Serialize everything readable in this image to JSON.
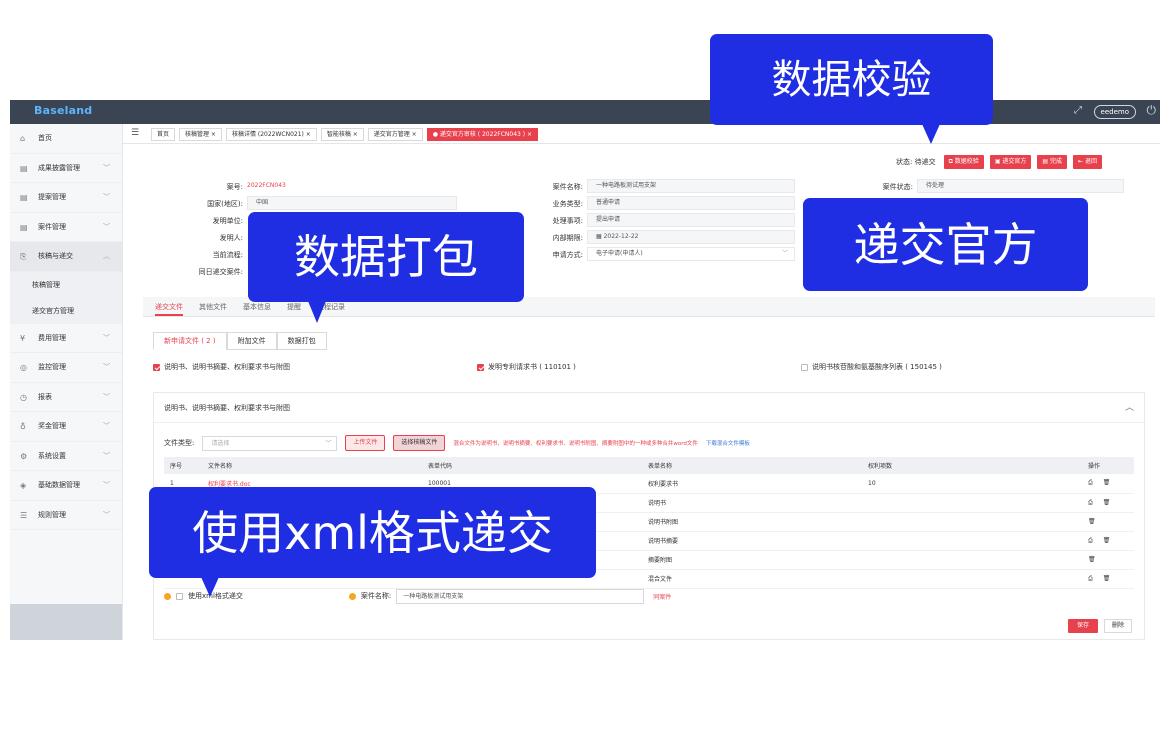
{
  "topbar": {
    "logo": "Baseland",
    "user": "eedemo",
    "expand_icon": "expand-icon",
    "power_icon": "power-icon"
  },
  "sidebar": {
    "items": [
      {
        "label": "首页",
        "icon": "home-icon"
      },
      {
        "label": "成果披露管理",
        "icon": "list-icon"
      },
      {
        "label": "提案管理",
        "icon": "list-icon"
      },
      {
        "label": "案件管理",
        "icon": "list-icon"
      },
      {
        "label": "核稿与递交",
        "icon": "file-icon"
      },
      {
        "label": "核稿管理",
        "icon": ""
      },
      {
        "label": "递交官方管理",
        "icon": ""
      },
      {
        "label": "费用管理",
        "icon": "money-icon"
      },
      {
        "label": "监控管理",
        "icon": "monitor-icon"
      },
      {
        "label": "报表",
        "icon": "clock-icon"
      },
      {
        "label": "奖金管理",
        "icon": "award-icon"
      },
      {
        "label": "系统设置",
        "icon": "gear-icon"
      },
      {
        "label": "基础数据管理",
        "icon": "layers-icon"
      },
      {
        "label": "规则管理",
        "icon": "sliders-icon"
      }
    ]
  },
  "breadcrumbs": [
    "首页",
    "核稿管理 ×",
    "核稿详情 (2022WCN021) ×",
    "智能核稿 ×",
    "递交官方管理 ×",
    "● 递交官方审核 ( 2022FCN043 ) ×"
  ],
  "actions": {
    "status": "状态: 待递交",
    "buttons": [
      "数据校验",
      "递交官方",
      "完成",
      "退回"
    ]
  },
  "form": {
    "case_no_label": "案号:",
    "case_no": "2022FCN043",
    "country_label": "国家(地区):",
    "country": "中国",
    "applicant_unit_label": "发明单位:",
    "inventor_label": "发明人:",
    "current_flow_label": "当前流程:",
    "same_submit_label": "同日递交案件:",
    "case_name_label": "案件名称:",
    "case_name": "一种电路板测试用支架",
    "business_type_label": "业务类型:",
    "business_type": "普通申请",
    "process_label": "处理事项:",
    "process": "提出申请",
    "deadline_label": "内部期限:",
    "deadline": "2022-12-22",
    "apply_method_label": "申请方式:",
    "apply_method": "电子申请(申请人)",
    "case_status_label": "案件状态:",
    "case_status": "待处理"
  },
  "tabs_main": [
    "递交文件",
    "其他文件",
    "基本信息",
    "提醒",
    "流程记录"
  ],
  "tabs_sub": [
    "新申请文件 ( 2 )",
    "附加文件",
    "数据打包"
  ],
  "checkboxes": [
    {
      "label": "说明书、说明书摘要、权利要求书与附图",
      "checked": true
    },
    {
      "label": "发明专利请求书 ( 110101 )",
      "checked": true
    },
    {
      "label": "说明书核苷酸和氨基酸序列表 ( 150145 )",
      "checked": false
    }
  ],
  "section": {
    "title": "说明书、说明书摘要、权利要求书与附图",
    "file_type_label": "文件类型:",
    "file_type_placeholder": "请选择",
    "upload_btn": "上传文件",
    "select_btn": "选择核稿文件",
    "hint": "混合文件为说明书、说明书摘要、权利要求书、说明书附图、摘要附图中的一种或多种合并word文件",
    "hint_link": "下载混合文件模板",
    "columns": [
      "序号",
      "文件名称",
      "表单代码",
      "表单名称",
      "权利项数",
      "操作"
    ],
    "rows": [
      {
        "no": "1",
        "file": "权利要求书.doc",
        "code": "100001",
        "form": "权利要求书",
        "claims": "10",
        "ops": "⎙ 🗑"
      },
      {
        "no": "",
        "file": "",
        "code": "",
        "form": "说明书",
        "claims": "",
        "ops": "⎙ 🗑"
      },
      {
        "no": "",
        "file": "",
        "code": "",
        "form": "说明书附图",
        "claims": "",
        "ops": "🗑"
      },
      {
        "no": "",
        "file": "",
        "code": "",
        "form": "说明书摘要",
        "claims": "",
        "ops": "⎙ 🗑"
      },
      {
        "no": "",
        "file": "",
        "code": "",
        "form": "摘要附图",
        "claims": "",
        "ops": "🗑"
      },
      {
        "no": "",
        "file": "",
        "code": "",
        "form": "混合文件",
        "claims": "",
        "ops": "⎙ 🗑"
      }
    ],
    "xml_label": "使用xml格式递交",
    "case_name_label": "案件名称:",
    "case_name": "一种电路板测试用支架",
    "same_case": "同案件",
    "save": "保存",
    "delete": "删除"
  },
  "callouts": {
    "validate": "数据校验",
    "submit": "递交官方",
    "pack": "数据打包",
    "xml": "使用xml格式递交"
  },
  "colors": {
    "accent": "#e8414e",
    "callout": "#1f2ee3",
    "topbar": "#3a4453"
  }
}
